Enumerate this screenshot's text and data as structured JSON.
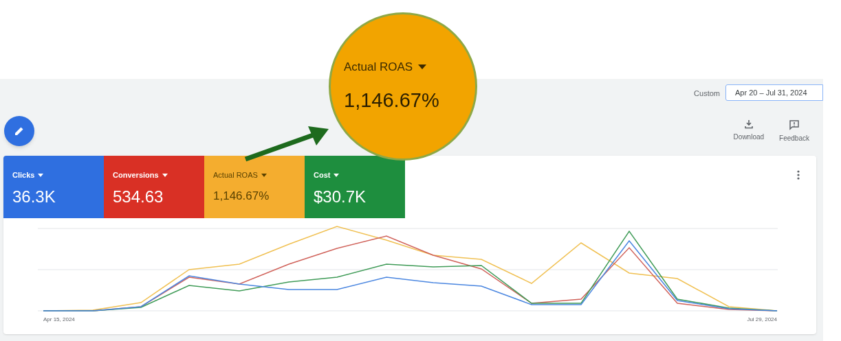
{
  "date_filter": {
    "label": "Custom",
    "value": "Apr 20 – Jul 31, 2024"
  },
  "actions": [
    {
      "label": "Download",
      "kind": "download"
    },
    {
      "label": "Feedback",
      "kind": "feedback"
    }
  ],
  "scorecards": [
    {
      "label": "Clicks",
      "value": "36.3K",
      "color": "#2f6fe0"
    },
    {
      "label": "Conversions",
      "value": "534.63",
      "color": "#d93025"
    },
    {
      "label": "Actual ROAS",
      "value": "1,146.67%",
      "color": "#f4ad2f"
    },
    {
      "label": "Cost",
      "value": "$30.7K",
      "color": "#1e8e3e"
    }
  ],
  "chart": {
    "x_labels": [
      "Apr 15, 2024",
      "Jul 29, 2024"
    ]
  },
  "callout": {
    "label": "Actual ROAS",
    "value": "1,146.67%"
  }
}
